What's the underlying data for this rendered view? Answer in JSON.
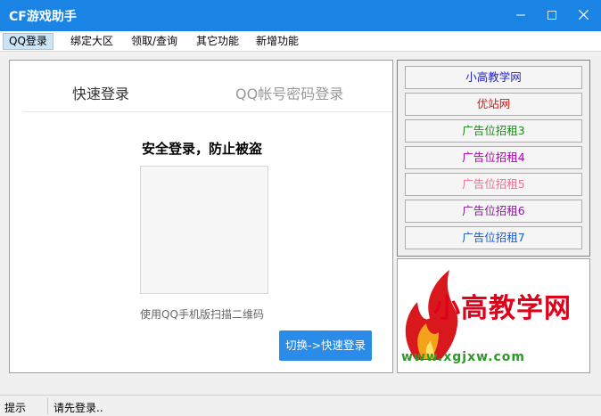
{
  "window": {
    "title": "CF游戏助手",
    "controls": {
      "minimize": "—",
      "maximize": "□",
      "close": "✕"
    }
  },
  "menu": {
    "items": [
      {
        "label": "QQ登录",
        "active": true
      },
      {
        "label": "绑定大区"
      },
      {
        "label": "领取/查询"
      },
      {
        "label": "其它功能"
      },
      {
        "label": "新增功能"
      }
    ]
  },
  "login": {
    "tab_quick": "快速登录",
    "tab_password": "QQ帐号密码登录",
    "title": "安全登录，防止被盗",
    "scan_hint": "使用QQ手机版扫描二维码",
    "switch_button": "切换->快速登录"
  },
  "ads": [
    {
      "label": "小高教学网",
      "color": "#1d1dcf"
    },
    {
      "label": "优站网",
      "color": "#e01010"
    },
    {
      "label": "广告位招租3",
      "color": "#1a8a1a"
    },
    {
      "label": "广告位招租4",
      "color": "#b000b0"
    },
    {
      "label": "广告位招租5",
      "color": "#f07090"
    },
    {
      "label": "广告位招租6",
      "color": "#8a1a9a"
    },
    {
      "label": "广告位招租7",
      "color": "#1a5acf"
    }
  ],
  "logo": {
    "text": "小高教学网",
    "url_text": "www.xgjxw.com"
  },
  "status": {
    "label": "提示",
    "message": "请先登录.."
  },
  "colors": {
    "titlebar": "#1a84e5",
    "switch_button": "#2a8ce8",
    "menu_active": "#cce4f7"
  }
}
